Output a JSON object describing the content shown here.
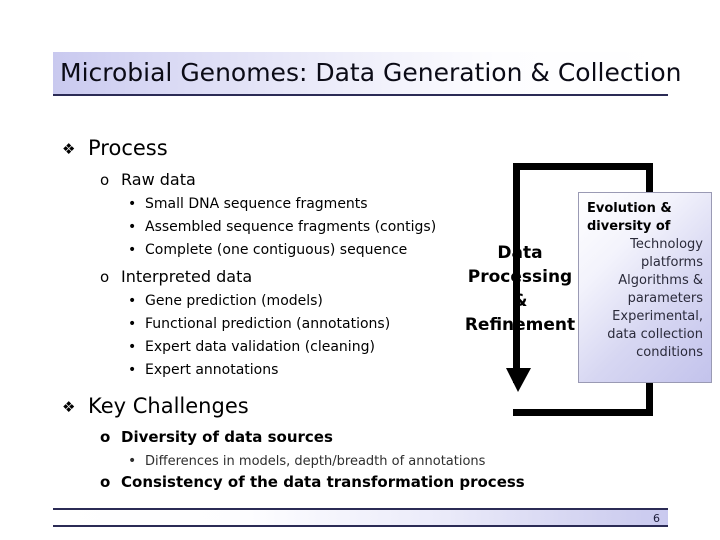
{
  "slide": {
    "title": "Microbial Genomes: Data Generation & Collection",
    "page_number": "6",
    "accent_color": "#2b2b55",
    "band_color": "#c9c9ef"
  },
  "outline": {
    "section1": {
      "bullet": "❖",
      "label": "Process",
      "groups": [
        {
          "bullet": "o",
          "label": "Raw data",
          "items": [
            {
              "bullet": "•",
              "text": "Small DNA sequence fragments"
            },
            {
              "bullet": "•",
              "text": "Assembled sequence fragments (contigs)"
            },
            {
              "bullet": "•",
              "text": "Complete (one contiguous) sequence"
            }
          ]
        },
        {
          "bullet": "o",
          "label": "Interpreted data",
          "items": [
            {
              "bullet": "•",
              "text": "Gene prediction (models)"
            },
            {
              "bullet": "•",
              "text": "Functional prediction (annotations)"
            },
            {
              "bullet": "•",
              "text": "Expert data validation (cleaning)"
            },
            {
              "bullet": "•",
              "text": "Expert annotations"
            }
          ]
        }
      ]
    },
    "section2": {
      "bullet": "❖",
      "label": "Key Challenges",
      "groups": [
        {
          "bullet": "o",
          "label": "Diversity of data sources",
          "items": [
            {
              "bullet": "•",
              "text": "Differences in models, depth/breadth of annotations"
            }
          ]
        },
        {
          "bullet": "o",
          "label": "Consistency of the data transformation process",
          "items": []
        }
      ]
    }
  },
  "diagram": {
    "process_label": "Data Processing & Refinement",
    "process_label_lines": [
      "Data",
      "Processing",
      "&",
      "Refinement"
    ],
    "factors_box": {
      "heading": "Evolution & diversity of",
      "items": [
        "Technology platforms",
        "Algorithms & parameters",
        "Experimental, data collection conditions"
      ]
    }
  }
}
